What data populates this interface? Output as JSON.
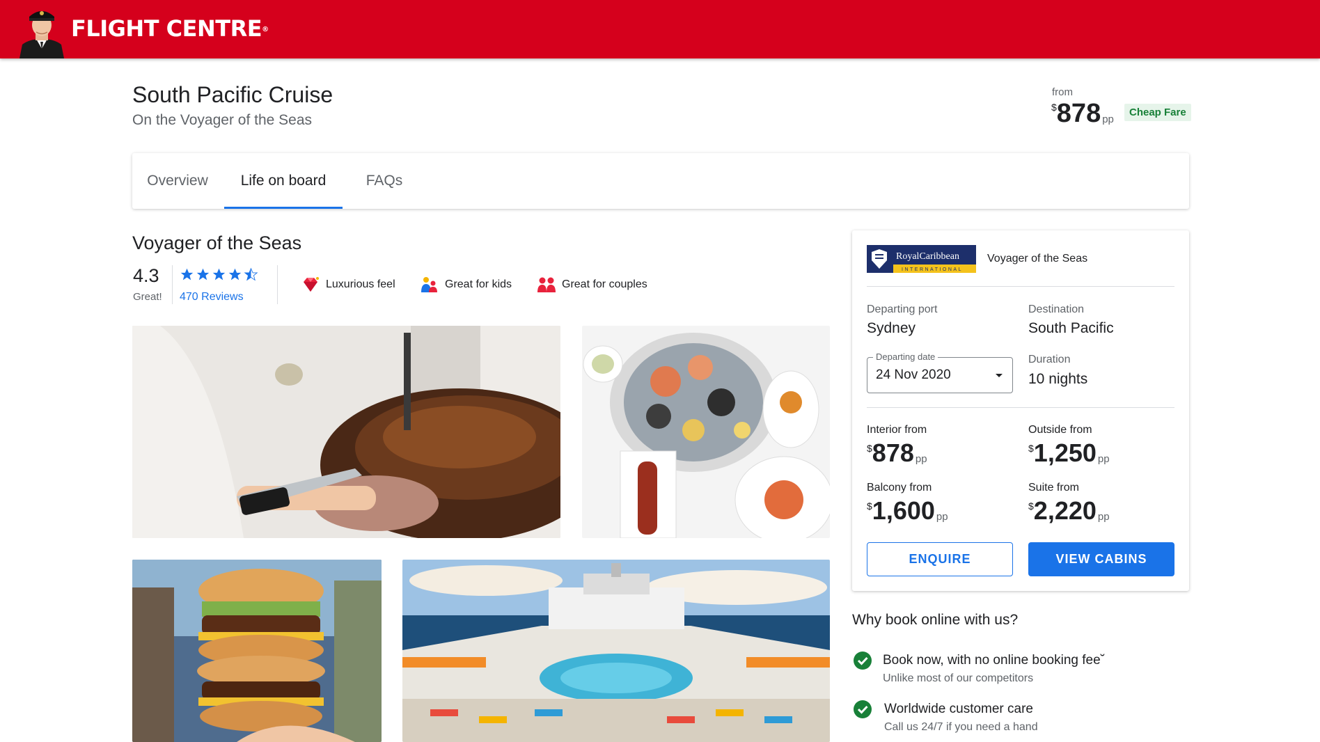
{
  "header": {
    "brand": "FLIGHT CENTRE",
    "brand_mark": "®",
    "brand_color": "#d5001c"
  },
  "cruise": {
    "title": "South Pacific Cruise",
    "subtitle": "On the Voyager of the Seas",
    "from_label": "from",
    "currency": "$",
    "price": "878",
    "pp": "pp",
    "badge": "Cheap Fare"
  },
  "tabs": [
    {
      "label": "Overview",
      "active": false
    },
    {
      "label": "Life on board",
      "active": true
    },
    {
      "label": "FAQs",
      "active": false
    }
  ],
  "ship": {
    "name": "Voyager of the Seas",
    "rating": "4.3",
    "rating_word": "Great!",
    "stars": 4.5,
    "reviews": "470 Reviews",
    "features": [
      {
        "icon": "diamond-icon",
        "label": "Luxurious feel"
      },
      {
        "icon": "family-icon",
        "label": "Great for kids"
      },
      {
        "icon": "couple-icon",
        "label": "Great for couples"
      }
    ]
  },
  "photos": [
    {
      "name": "photo-carving-roast"
    },
    {
      "name": "photo-seafood-platter"
    },
    {
      "name": "photo-burger-stack"
    },
    {
      "name": "photo-pool-deck"
    }
  ],
  "booking": {
    "logo_line1": "RoyalCaribbean",
    "logo_line2": "INTERNATIONAL",
    "ship": "Voyager of the Seas",
    "departing_port_label": "Departing port",
    "departing_port": "Sydney",
    "destination_label": "Destination",
    "destination": "South Pacific",
    "departing_date_label": "Departing date",
    "departing_date": "24 Nov 2020",
    "duration_label": "Duration",
    "duration": "10 nights",
    "currency": "$",
    "pp": "pp",
    "cabins": [
      {
        "label": "Interior from",
        "price": "878"
      },
      {
        "label": "Outside from",
        "price": "1,250"
      },
      {
        "label": "Balcony from",
        "price": "1,600"
      },
      {
        "label": "Suite from",
        "price": "2,220"
      }
    ],
    "enquire": "ENQUIRE",
    "view_cabins": "VIEW CABINS"
  },
  "why": {
    "title": "Why book online with us?",
    "items": [
      {
        "main": "Book now, with no online booking fee˘",
        "sub": "Unlike most of our competitors"
      },
      {
        "main": "Worldwide customer care",
        "sub": "Call us 24/7 if you need a hand"
      }
    ]
  },
  "colors": {
    "accent": "#1a73e8",
    "success": "#188038",
    "badge_bg": "#e6f4ea"
  }
}
